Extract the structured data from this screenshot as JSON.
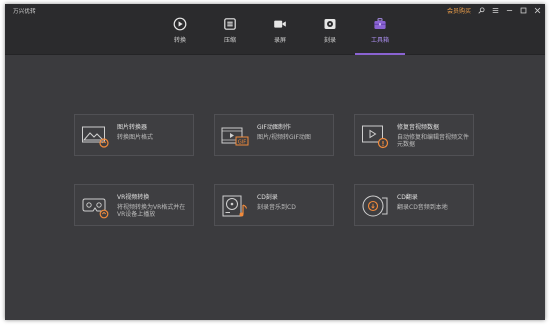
{
  "app": {
    "title": "万兴优转"
  },
  "nav": {
    "tabs": [
      {
        "key": "convert",
        "label": "转换",
        "icon": "play-circle-icon"
      },
      {
        "key": "compress",
        "label": "压缩",
        "icon": "compress-icon"
      },
      {
        "key": "record",
        "label": "录屏",
        "icon": "video-camera-icon"
      },
      {
        "key": "burn",
        "label": "刻录",
        "icon": "disc-icon"
      },
      {
        "key": "toolbox",
        "label": "工具箱",
        "icon": "toolbox-icon",
        "active": true
      }
    ]
  },
  "window": {
    "vip_label": "会员购买"
  },
  "tools": [
    {
      "title": "图片转换器",
      "desc": "转换图片格式",
      "icon": "image-convert-icon"
    },
    {
      "title": "GIF动图制作",
      "desc": "图片/视频转GIF动图",
      "icon": "gif-maker-icon"
    },
    {
      "title": "修复音视频数据",
      "desc": "自动修复和编辑音视频文件元数据",
      "icon": "metadata-fix-icon"
    },
    {
      "title": "VR视频转换",
      "desc": "将视频转换为VR格式并在VR设备上播放",
      "icon": "vr-headset-icon"
    },
    {
      "title": "CD刻录",
      "desc": "刻录音乐到CD",
      "icon": "cd-burn-icon"
    },
    {
      "title": "CD翻录",
      "desc": "翻录CD音频到本地",
      "icon": "cd-rip-icon"
    }
  ],
  "colors": {
    "accent": "#8a63d2",
    "orange": "#f08a3c",
    "background": "#3b3b3e",
    "topbar": "#2b2b2d"
  }
}
